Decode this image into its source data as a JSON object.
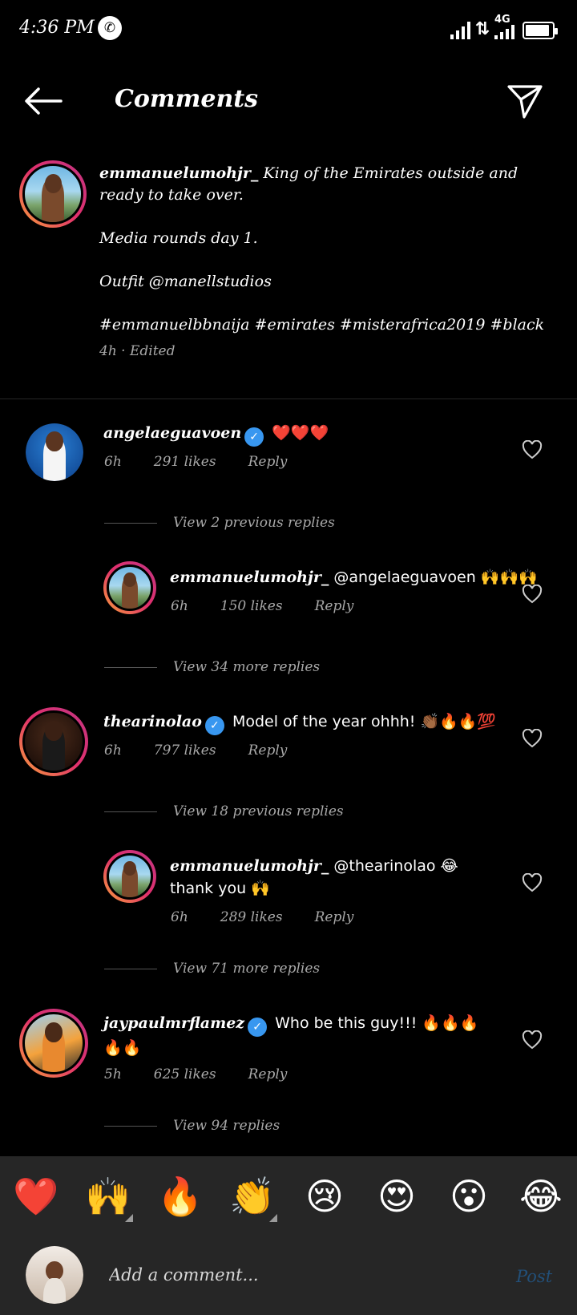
{
  "status": {
    "time": "4:36 PM",
    "network": "4G"
  },
  "header": {
    "title": "Comments"
  },
  "caption": {
    "username": "emmanuelumohjr_",
    "text1": "King of the Emirates outside and ready to take over.",
    "text2": "Media rounds day 1.",
    "text3": "Outfit @manellstudios",
    "text4": "#emmanuelbbnaija #emirates #misterafrica2019 #black",
    "meta": "4h · Edited"
  },
  "comments": [
    {
      "username": "angelaeguavoen",
      "text": "❤️❤️❤️",
      "time": "6h",
      "likes": "291 likes",
      "reply": "Reply"
    },
    {
      "view_label": "View 2 previous replies"
    },
    {
      "username": "emmanuelumohjr_",
      "text": "@angelaeguavoen 🙌🙌🙌",
      "time": "6h",
      "likes": "150 likes",
      "reply": "Reply"
    },
    {
      "view_label": "View 34 more replies"
    },
    {
      "username": "thearinolao",
      "text": "Model of the year ohhh! 👏🏾🔥🔥💯",
      "time": "6h",
      "likes": "797 likes",
      "reply": "Reply"
    },
    {
      "view_label": "View 18 previous replies"
    },
    {
      "username": "emmanuelumohjr_",
      "text": "@thearinolao 😂 thank you 🙌",
      "time": "6h",
      "likes": "289 likes",
      "reply": "Reply"
    },
    {
      "view_label": "View 71 more replies"
    },
    {
      "username": "jaypaulmrflamez",
      "text": "Who be this guy!!! 🔥🔥🔥🔥🔥",
      "time": "5h",
      "likes": "625 likes",
      "reply": "Reply"
    },
    {
      "view_label": "View 94 replies"
    }
  ],
  "emoji_bar": [
    "❤️",
    "🙌",
    "🔥",
    "👏",
    "😢",
    "😍",
    "😮",
    "😂"
  ],
  "input": {
    "placeholder": "Add a comment...",
    "post_label": "Post"
  },
  "colors": {
    "background": "#000000",
    "panel": "#262626",
    "verified": "#3897f0",
    "post_disabled": "#224f78"
  }
}
